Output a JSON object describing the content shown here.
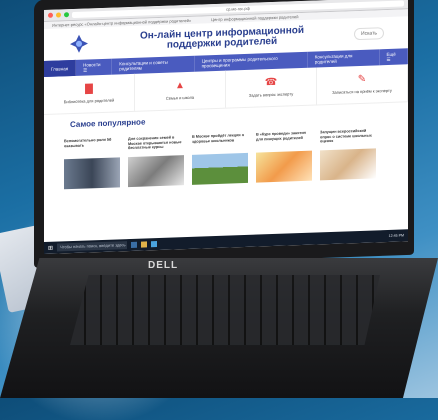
{
  "browser": {
    "url": "cp.мо-гос.рф",
    "tab_left": "Интернет-ресурс «Онлайн-центр информационной поддержки родителей»",
    "tab_right": "Центр информационной поддержки родителей"
  },
  "site": {
    "title_line1": "Он-лайн центр информационной",
    "title_line2": "поддержки родителей",
    "search_label": "Искать"
  },
  "nav": {
    "items": [
      {
        "label": "Главная"
      },
      {
        "label": "Новости ☰"
      },
      {
        "label": "Консультации и советы родителям"
      },
      {
        "label": "Центры и программы родительского просвещения"
      },
      {
        "label": "Консультации для родителей"
      },
      {
        "label": "Ещё ☰"
      }
    ]
  },
  "quick_links": [
    {
      "label": "Библиотека для родителей",
      "icon": "book-icon"
    },
    {
      "label": "Семья и школа",
      "icon": "bell-icon"
    },
    {
      "label": "Задать вопрос эксперту",
      "icon": "phone-icon"
    },
    {
      "label": "Записаться на приём к эксперту",
      "icon": "pencil-icon"
    }
  ],
  "popular": {
    "title": "Самое популярное",
    "cards": [
      {
        "text": "Вспомогательно роли 5б оказывать"
      },
      {
        "text": "Для сохранения семей в Москве открываются новые бесплатные курсы"
      },
      {
        "text": "В Москве пройдёт лекция о здоровье школьников"
      },
      {
        "text": "В «Курс проведи» занятия для пишущих родителей"
      },
      {
        "text": "Запущен всероссийский опрос о системе школьных оценок"
      }
    ]
  },
  "taskbar": {
    "search_placeholder": "Чтобы начать поиск, введите здесь текст",
    "time": "12:45 PM"
  },
  "laptop": {
    "brand": "DELL"
  }
}
